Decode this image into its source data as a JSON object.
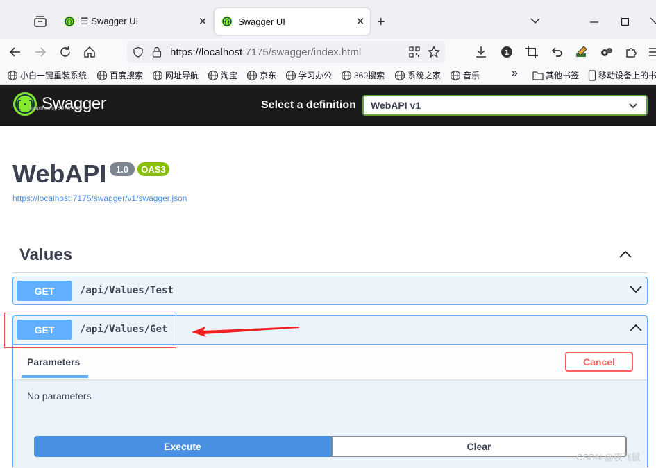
{
  "browser": {
    "tabs": [
      {
        "title": "☰ Swagger UI",
        "active": false
      },
      {
        "title": "Swagger UI",
        "active": true
      }
    ],
    "new_tab": "+",
    "url_host": "https://localhost",
    "url_rest": ":7175/swagger/index.html",
    "bookmarks": [
      "小白一键重装系统",
      "百度搜索",
      "网址导航",
      "淘宝",
      "京东",
      "学习办公",
      "360搜索",
      "系统之家",
      "音乐"
    ],
    "bookmarks_overflow": "»",
    "other_bookmarks": "其他书签",
    "mobile_bookmarks": "移动设备上的书"
  },
  "topbar": {
    "logo_name": "Swagger",
    "logo_sub": "Supported by SMARTBEAR",
    "definition_label": "Select a definition",
    "definition_value": "WebAPI v1"
  },
  "info": {
    "title": "WebAPI",
    "version": "1.0",
    "oas": "OAS3",
    "spec_url": "https://localhost:7175/swagger/v1/swagger.json"
  },
  "tag": {
    "name": "Values",
    "operations": [
      {
        "method": "GET",
        "path": "/api/Values/Test",
        "expanded": false
      },
      {
        "method": "GET",
        "path": "/api/Values/Get",
        "expanded": true
      }
    ]
  },
  "op_panel": {
    "params_tab": "Parameters",
    "cancel": "Cancel",
    "no_params": "No parameters",
    "execute": "Execute",
    "clear": "Clear"
  },
  "watermark": "CSDN @夜飞鼠",
  "colors": {
    "get": "#61affe",
    "execute": "#4990e2",
    "cancel": "#ff6060",
    "oas_badge": "#89bf04",
    "annotation": "#f05050"
  }
}
